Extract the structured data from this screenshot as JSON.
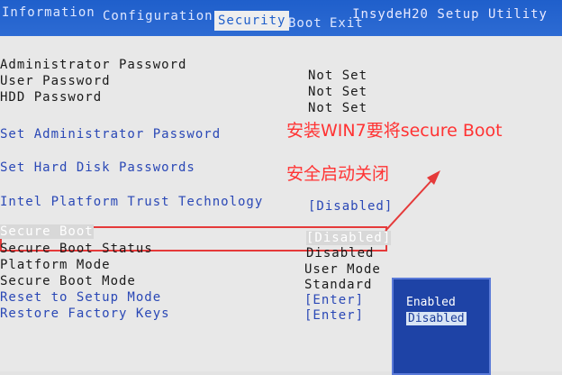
{
  "tabs": [
    "Information",
    "Configuration",
    "Security",
    "Boot",
    "Exit"
  ],
  "brand": "InsydeH20 Setup Utility",
  "password_rows": [
    {
      "label": "Administrator Password",
      "value": "Not Set"
    },
    {
      "label": "User Password",
      "value": "Not Set"
    },
    {
      "label": "HDD Password",
      "value": "Not Set"
    }
  ],
  "set_admin_password": "Set Administrator Password",
  "set_hdd_passwords": "Set Hard Disk Passwords",
  "intel_ptt": {
    "label": "Intel Platform Trust Technology",
    "value": "[Disabled]"
  },
  "secure_boot": {
    "label": "Secure Boot",
    "value": "[Disabled]"
  },
  "secure_boot_status": {
    "label": "Secure Boot Status",
    "value": "Disabled"
  },
  "platform_mode": {
    "label": "Platform Mode",
    "value": "User Mode"
  },
  "secure_boot_mode": {
    "label": "Secure Boot Mode",
    "value": "Standard"
  },
  "reset_setup_mode": {
    "label": "Reset to Setup Mode",
    "value": "[Enter]"
  },
  "restore_keys": {
    "label": "Restore Factory Keys",
    "value": "[Enter]"
  },
  "annotation": {
    "line1": "安装WIN7要将secure Boot",
    "line2": "安全启动关闭"
  },
  "popup": {
    "options": [
      "Enabled",
      "Disabled"
    ],
    "selected": "Disabled"
  },
  "colors": {
    "accent_blue": "#1f5fcb",
    "highlight_red": "#e53a3a"
  }
}
